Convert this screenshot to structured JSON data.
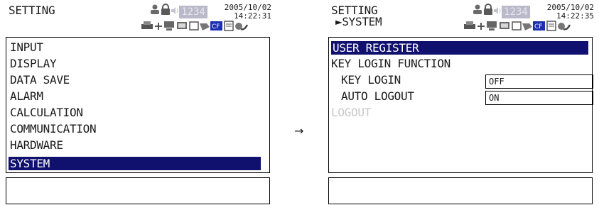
{
  "colors": {
    "selection": "#10106e",
    "counter_bg": "#b9b9c9",
    "disabled_text": "#c8c8c8"
  },
  "flow_arrow": "→",
  "left_screen": {
    "title": "SETTING",
    "status": {
      "date": "2005/10/02",
      "time": "14:22:31",
      "counter": "1234"
    },
    "menu": [
      "INPUT",
      "DISPLAY",
      "DATA SAVE",
      "ALARM",
      "CALCULATION",
      "COMMUNICATION",
      "HARDWARE",
      "SYSTEM"
    ],
    "selected": "SYSTEM"
  },
  "right_screen": {
    "title": "SETTING",
    "breadcrumb": "►SYSTEM",
    "status": {
      "date": "2005/10/02",
      "time": "14:22:35",
      "counter": "1234"
    },
    "menu": {
      "user_register": "USER REGISTER",
      "key_login_function": "KEY LOGIN FUNCTION",
      "key_login": "KEY LOGIN",
      "auto_logout": "AUTO LOGOUT",
      "logout": "LOGOUT"
    },
    "values": {
      "key_login": "OFF",
      "auto_logout": "ON"
    },
    "selected": "USER REGISTER"
  },
  "icons": [
    "user-icon",
    "lock-icon",
    "sound-icon",
    "printer-icon",
    "network-icon",
    "pc-icon",
    "monitor-icon",
    "card-icon",
    "cf-card-icon",
    "document-icon",
    "paint-icon"
  ]
}
